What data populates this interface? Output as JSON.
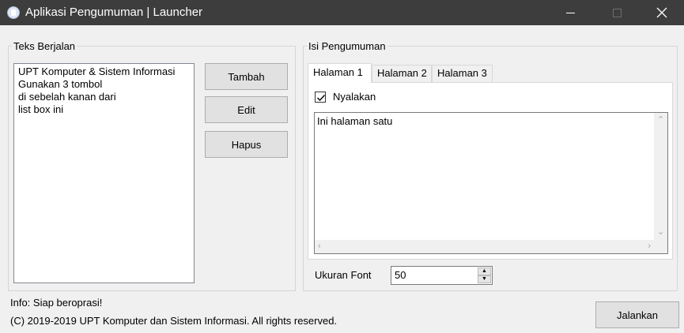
{
  "window": {
    "title": "Aplikasi Pengumuman | Launcher",
    "icon": "app-icon"
  },
  "left_group": {
    "legend": "Teks Berjalan",
    "list_items": [
      "UPT Komputer & Sistem Informasi",
      "Gunakan 3 tombol",
      "di sebelah kanan dari",
      "list box ini"
    ],
    "buttons": {
      "add": "Tambah",
      "edit": "Edit",
      "delete": "Hapus"
    }
  },
  "right_group": {
    "legend": "Isi Pengumuman",
    "tabs": [
      {
        "label": "Halaman 1",
        "active": true
      },
      {
        "label": "Halaman 2",
        "active": false
      },
      {
        "label": "Halaman 3",
        "active": false
      }
    ],
    "checkbox": {
      "label": "Nyalakan",
      "checked": true
    },
    "textarea_value": "Ini halaman satu",
    "font_size": {
      "label": "Ukuran Font",
      "value": "50"
    }
  },
  "footer": {
    "status": "Info: Siap beroprasi!",
    "copyright": "(C) 2019-2019 UPT Komputer dan Sistem Informasi. All rights reserved.",
    "run_button": "Jalankan"
  }
}
